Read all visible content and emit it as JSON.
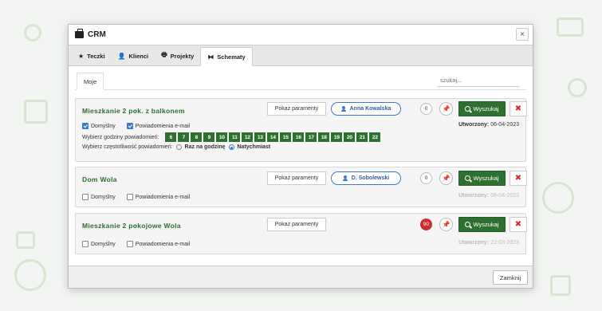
{
  "window": {
    "title": "CRM",
    "close_symbol": "×"
  },
  "tabs": [
    {
      "label": "Teczki",
      "icon": "star-icon"
    },
    {
      "label": "Klienci",
      "icon": "user-icon"
    },
    {
      "label": "Projekty",
      "icon": "printer-icon"
    },
    {
      "label": "Schematy",
      "icon": "schema-icon",
      "active": true
    }
  ],
  "subtab": {
    "label": "Moje"
  },
  "search": {
    "placeholder": "szukaj..."
  },
  "cards": [
    {
      "title": "Mieszkanie 2 pok. z balkonem",
      "params_label": "Pokaż paramenty",
      "user_label": "Anna Kowalska",
      "count": "0",
      "search_label": "Wyszukaj",
      "default_label": "Domyślny",
      "default_checked": true,
      "email_label": "Powiadomienia e-mail",
      "email_checked": true,
      "created_label": "Utworzony:",
      "created_date": "06-04-2023",
      "hours_label": "Wybierz godziny powiadomień:",
      "hours": [
        "6",
        "7",
        "8",
        "9",
        "10",
        "11",
        "12",
        "13",
        "14",
        "15",
        "16",
        "17",
        "18",
        "19",
        "20",
        "21",
        "22"
      ],
      "freq_label": "Wybierz częstotliwość powiadomień:",
      "freq_options": [
        "Raz na godzinę",
        "Natychmiast"
      ],
      "freq_selected": "Natychmiast"
    },
    {
      "title": "Dom Wola",
      "params_label": "Pokaż paramenty",
      "user_label": "D. Sobolewski",
      "count": "0",
      "search_label": "Wyszukaj",
      "default_label": "Domyślny",
      "default_checked": false,
      "email_label": "Powiadomienia e-mail",
      "email_checked": false,
      "created_label": "Utworzony:",
      "created_date": "06-04-2023"
    },
    {
      "title": "Mieszkanie 2 pokojowe Wola",
      "params_label": "Pokaż paramenty",
      "count": "90",
      "search_label": "Wyszukaj",
      "default_label": "Domyślny",
      "default_checked": false,
      "email_label": "Powiadomienia e-mail",
      "email_checked": false,
      "created_label": "Utworzony:",
      "created_date": "22-03-2023"
    }
  ],
  "footer": {
    "close_label": "Zamknij"
  },
  "colors": {
    "accent_green": "#2e7030",
    "link_blue": "#3a7bc8",
    "danger_red": "#c9302c"
  }
}
